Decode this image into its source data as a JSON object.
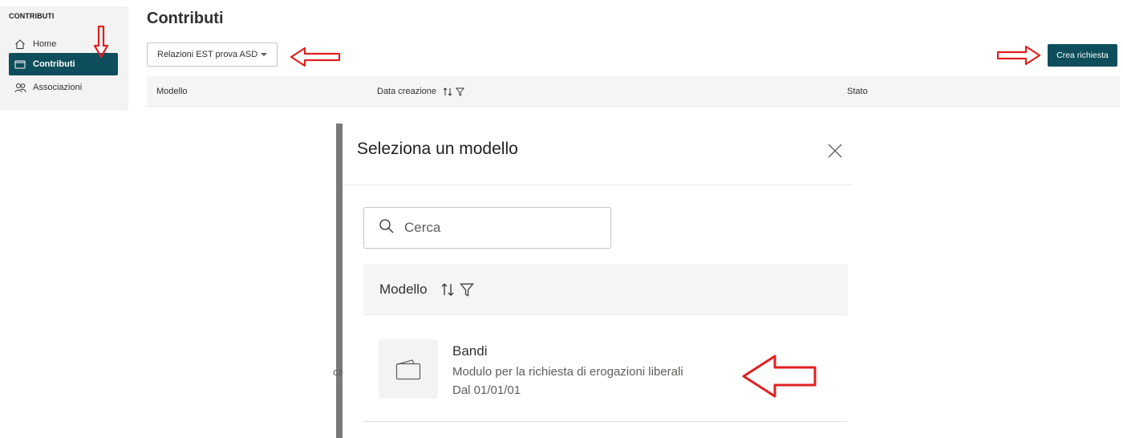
{
  "sidebar": {
    "section": "CONTRIBUTI",
    "items": [
      {
        "label": "Home",
        "icon": "home-icon"
      },
      {
        "label": "Contributi",
        "icon": "folder-icon",
        "active": true
      },
      {
        "label": "Associazioni",
        "icon": "people-icon"
      }
    ]
  },
  "page": {
    "title": "Contributi",
    "dropdown_value": "Relazioni EST prova ASD",
    "create_button": "Crea richiesta",
    "columns": [
      "Modello",
      "Data creazione",
      "Stato"
    ]
  },
  "background_peek": "ca",
  "modal": {
    "title": "Seleziona un modello",
    "search_placeholder": "Cerca",
    "column": "Modello",
    "rows": [
      {
        "title": "Bandi",
        "description": "Modulo per la richiesta di erogazioni liberali",
        "date": "Dal 01/01/01",
        "icon": "folder-icon"
      }
    ]
  },
  "colors": {
    "accent": "#0e4d5b",
    "annotation": "#e02020",
    "sidebar_bg": "#f3f3f3"
  }
}
